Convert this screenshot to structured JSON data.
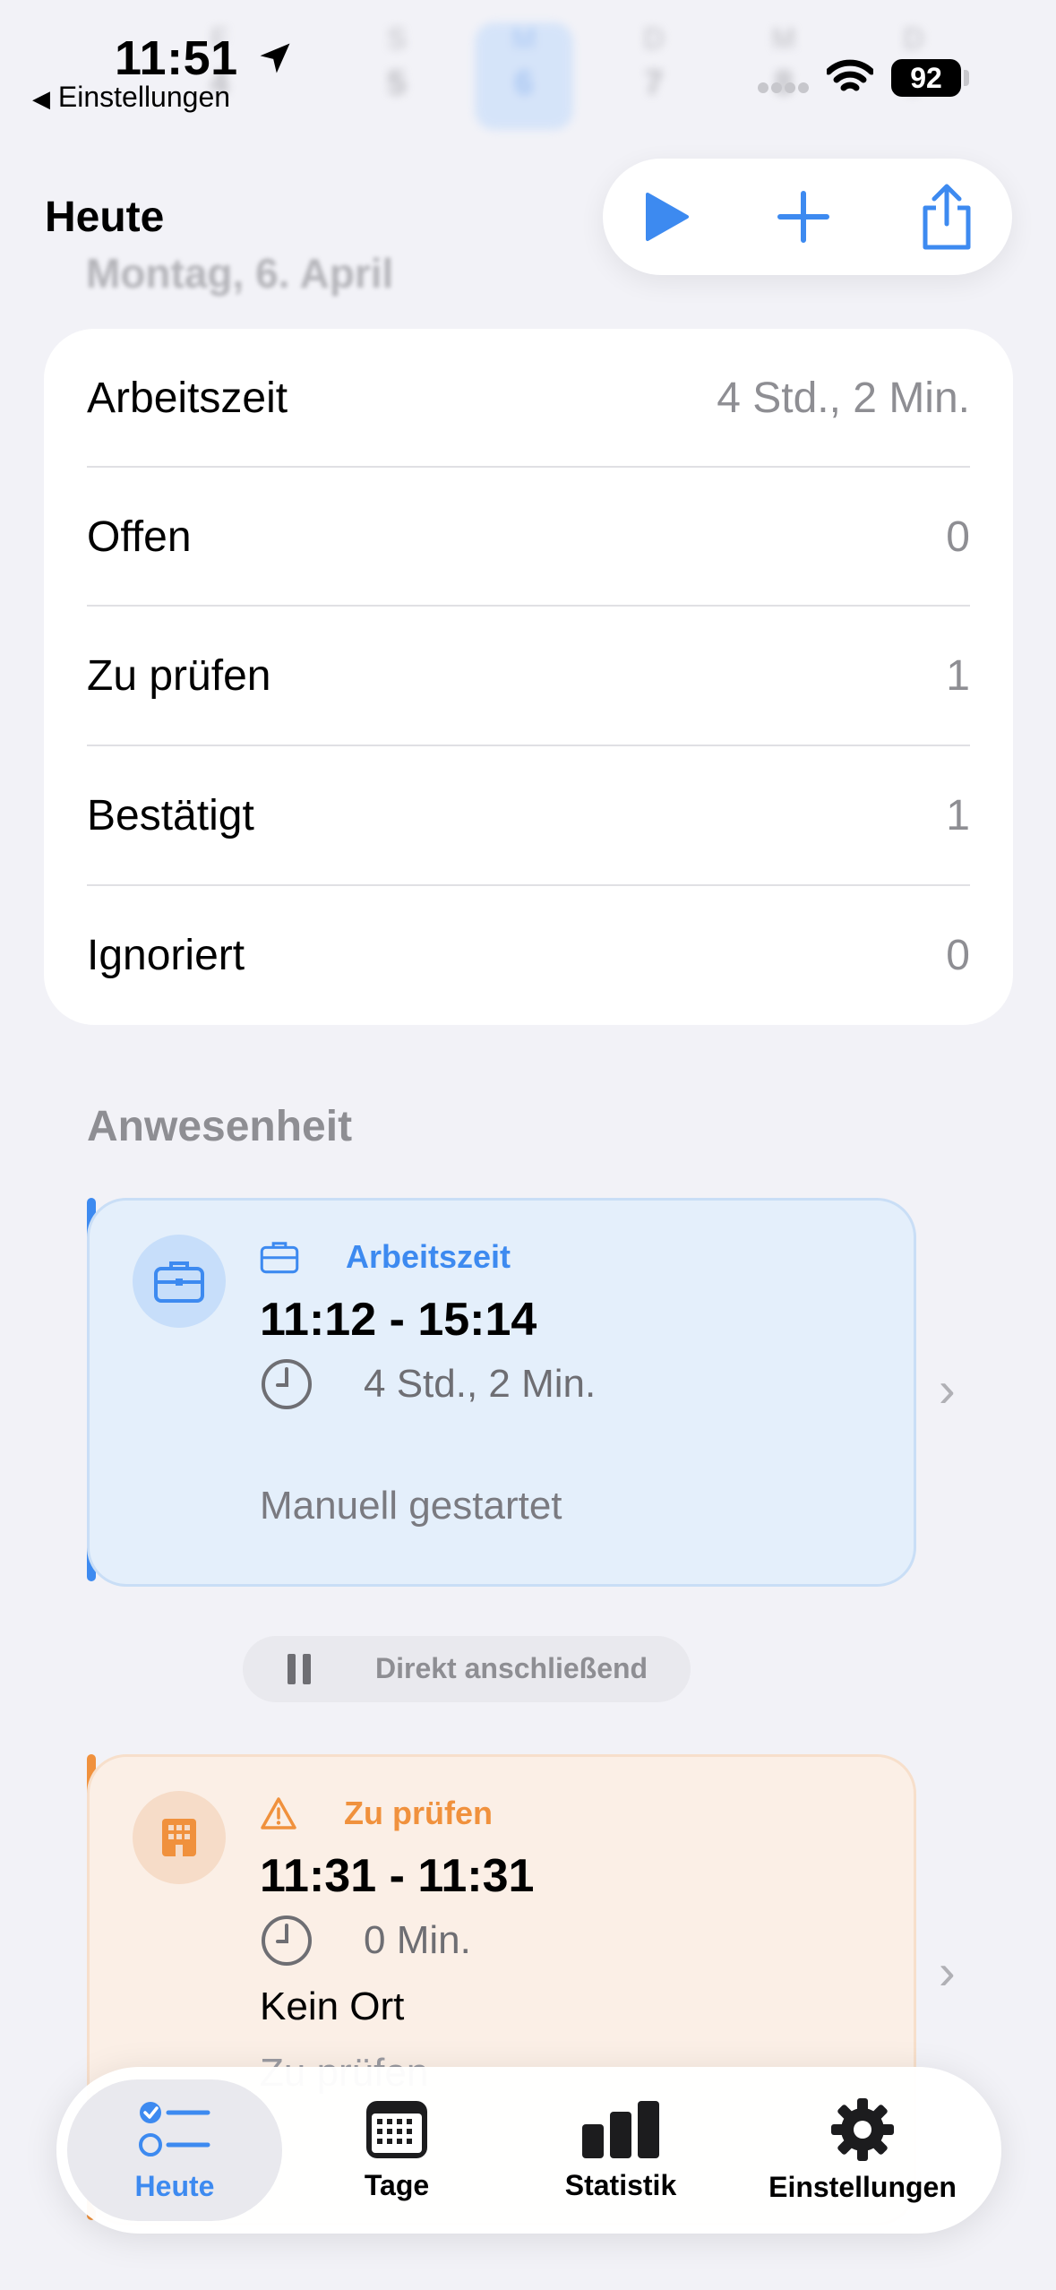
{
  "week": [
    {
      "wd": "F",
      "dn": "4"
    },
    {
      "wd": "S",
      "dn": "5"
    },
    {
      "wd": "M",
      "dn": "6",
      "selected": true
    },
    {
      "wd": "D",
      "dn": "7"
    },
    {
      "wd": "M",
      "dn": "8"
    },
    {
      "wd": "D",
      "dn": "9"
    }
  ],
  "status": {
    "time": "11:51",
    "back_label": "Einstellungen",
    "battery": "92"
  },
  "header": {
    "title": "Heute",
    "subtitle": "Montag, 6. April"
  },
  "toolbar": {
    "play_icon": "play-icon",
    "add_icon": "plus-icon",
    "share_icon": "share-icon"
  },
  "summary": {
    "rows": [
      {
        "label": "Arbeitszeit",
        "value": "4 Std., 2 Min."
      },
      {
        "label": "Offen",
        "value": "0"
      },
      {
        "label": "Zu prüfen",
        "value": "1"
      },
      {
        "label": "Bestätigt",
        "value": "1"
      },
      {
        "label": "Ignoriert",
        "value": "0"
      }
    ]
  },
  "section_title": "Anwesenheit",
  "entries": [
    {
      "label": "Arbeitszeit",
      "time": "11:12 - 15:14",
      "duration": "4 Std., 2 Min.",
      "note": "Manuell gestartet",
      "accent": "#3D8AF0"
    },
    {
      "label": "Zu prüfen",
      "time": "11:31 - 11:31",
      "duration": "0 Min.",
      "place": "Kein Ort",
      "note": "Zu prüfen",
      "accent": "#F0913D"
    }
  ],
  "pause_pill": {
    "label": "Direkt anschließend"
  },
  "tabs": [
    {
      "label": "Heute",
      "icon": "checklist-icon",
      "active": true
    },
    {
      "label": "Tage",
      "icon": "calendar-icon"
    },
    {
      "label": "Statistik",
      "icon": "bar-chart-icon"
    },
    {
      "label": "Einstellungen",
      "icon": "gear-icon"
    }
  ]
}
